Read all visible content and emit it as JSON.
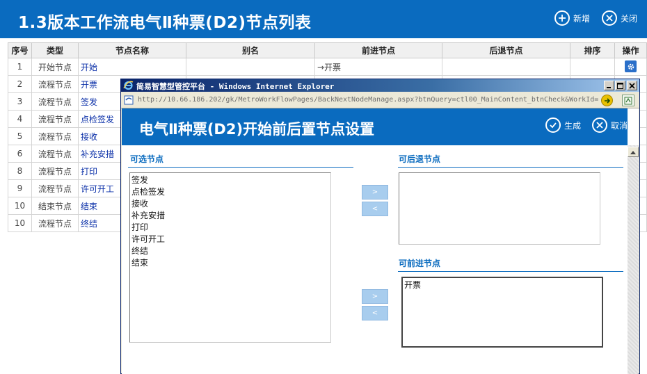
{
  "page": {
    "title": "1.3版本工作流电气Ⅱ种票(D2)节点列表",
    "add_label": "新增",
    "close_label": "关闭"
  },
  "table": {
    "headers": [
      "序号",
      "类型",
      "节点名称",
      "别名",
      "前进节点",
      "后退节点",
      "排序",
      "操作"
    ],
    "rows": [
      {
        "no": "1",
        "type": "开始节点",
        "name": "开始",
        "alias": "",
        "forward": "→开票",
        "back": "",
        "order": ""
      },
      {
        "no": "2",
        "type": "流程节点",
        "name": "开票"
      },
      {
        "no": "3",
        "type": "流程节点",
        "name": "签发"
      },
      {
        "no": "4",
        "type": "流程节点",
        "name": "点检签发"
      },
      {
        "no": "5",
        "type": "流程节点",
        "name": "接收"
      },
      {
        "no": "6",
        "type": "流程节点",
        "name": "补充安措"
      },
      {
        "no": "8",
        "type": "流程节点",
        "name": "打印"
      },
      {
        "no": "9",
        "type": "流程节点",
        "name": "许可开工"
      },
      {
        "no": "10",
        "type": "结束节点",
        "name": "结束"
      },
      {
        "no": "10",
        "type": "流程节点",
        "name": "终结"
      }
    ]
  },
  "ie": {
    "title": "简易智慧型管控平台 - Windows Internet Explorer",
    "address": "http://10.66.186.202/gk/MetroWorkFlowPages/BackNextNodeManage.aspx?btnQuery=ctl00_MainContent_btnCheck&WorkId="
  },
  "dialog": {
    "title": "电气Ⅱ种票(D2)开始前后置节点设置",
    "generate_label": "生成",
    "cancel_label": "取消",
    "available": {
      "title": "可选节点",
      "items": [
        "签发",
        "点检签发",
        "接收",
        "补充安措",
        "打印",
        "许可开工",
        "终结",
        "结束"
      ]
    },
    "back_nodes": {
      "title": "可后退节点",
      "items": []
    },
    "forward_nodes": {
      "title": "可前进节点",
      "items": [
        "开票"
      ]
    },
    "move_right": ">",
    "move_left": "<"
  },
  "colors": {
    "header_blue": "#0a6bbf",
    "link_blue": "#0a2fa8",
    "move_button": "#a8cdee"
  }
}
